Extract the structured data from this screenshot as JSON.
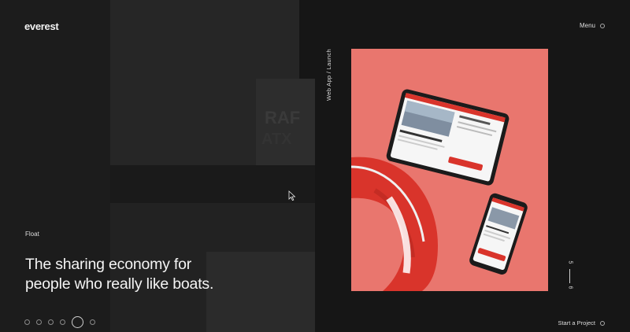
{
  "header": {
    "logo": "everest",
    "menu_label": "Menu"
  },
  "project": {
    "name": "Float",
    "headline_line1": "The sharing economy for",
    "headline_line2": "people who really like boats.",
    "category": "Web App / Launch",
    "image": "tablet-and-phone-with-life-ring-on-coral"
  },
  "pager": {
    "current": "5",
    "total": "6"
  },
  "slider": {
    "dot_count": 6,
    "active_index": 4
  },
  "footer": {
    "cta_label": "Start a Project"
  },
  "colors": {
    "background": "#161616",
    "hero_coral": "#e9766e",
    "accent_red": "#d9342b",
    "text": "#f4f4f4"
  },
  "icons": [
    "menu-ring-icon",
    "start-ring-icon",
    "mouse-cursor-icon"
  ]
}
